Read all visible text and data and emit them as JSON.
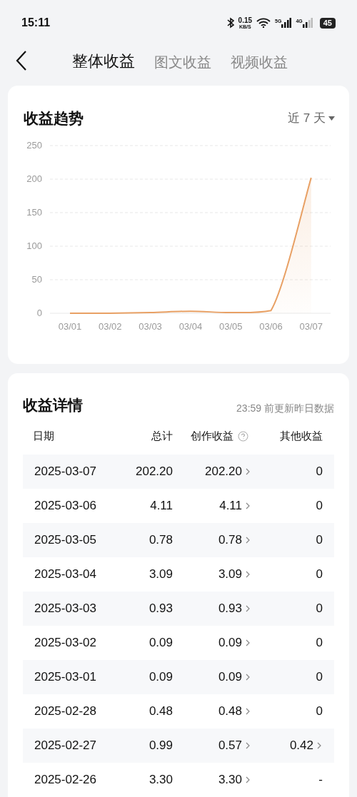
{
  "status_bar": {
    "time": "15:11",
    "net_speed": "0.15",
    "net_unit": "KB/S",
    "sim1": "5G",
    "sim2": "4G",
    "battery": "45"
  },
  "nav": {
    "tabs": [
      {
        "label": "整体收益",
        "selected": true
      },
      {
        "label": "图文收益",
        "selected": false
      },
      {
        "label": "视频收益",
        "selected": false
      }
    ]
  },
  "trend_card": {
    "title": "收益趋势",
    "range": "近 7 天",
    "chart_data": {
      "type": "line",
      "categories": [
        "03/01",
        "03/02",
        "03/03",
        "03/04",
        "03/05",
        "03/06",
        "03/07"
      ],
      "ylim": [
        0,
        250
      ],
      "yticks": [
        0,
        50,
        100,
        150,
        200,
        250
      ],
      "grid": true,
      "series": [
        {
          "color": "#e8a064",
          "values": [
            0,
            0,
            1,
            3,
            1,
            4,
            202
          ]
        }
      ]
    }
  },
  "detail_card": {
    "title": "收益详情",
    "note": "23:59 前更新昨日数据",
    "columns": [
      "日期",
      "总计",
      "创作收益",
      "其他收益"
    ],
    "rows": [
      {
        "date": "2025-03-07",
        "total": "202.20",
        "creation": "202.20",
        "other": "0",
        "other_link": false
      },
      {
        "date": "2025-03-06",
        "total": "4.11",
        "creation": "4.11",
        "other": "0",
        "other_link": false
      },
      {
        "date": "2025-03-05",
        "total": "0.78",
        "creation": "0.78",
        "other": "0",
        "other_link": false
      },
      {
        "date": "2025-03-04",
        "total": "3.09",
        "creation": "3.09",
        "other": "0",
        "other_link": false
      },
      {
        "date": "2025-03-03",
        "total": "0.93",
        "creation": "0.93",
        "other": "0",
        "other_link": false
      },
      {
        "date": "2025-03-02",
        "total": "0.09",
        "creation": "0.09",
        "other": "0",
        "other_link": false
      },
      {
        "date": "2025-03-01",
        "total": "0.09",
        "creation": "0.09",
        "other": "0",
        "other_link": false
      },
      {
        "date": "2025-02-28",
        "total": "0.48",
        "creation": "0.48",
        "other": "0",
        "other_link": false
      },
      {
        "date": "2025-02-27",
        "total": "0.99",
        "creation": "0.57",
        "other": "0.42",
        "other_link": true
      },
      {
        "date": "2025-02-26",
        "total": "3.30",
        "creation": "3.30",
        "other": "-",
        "other_link": false
      }
    ]
  }
}
